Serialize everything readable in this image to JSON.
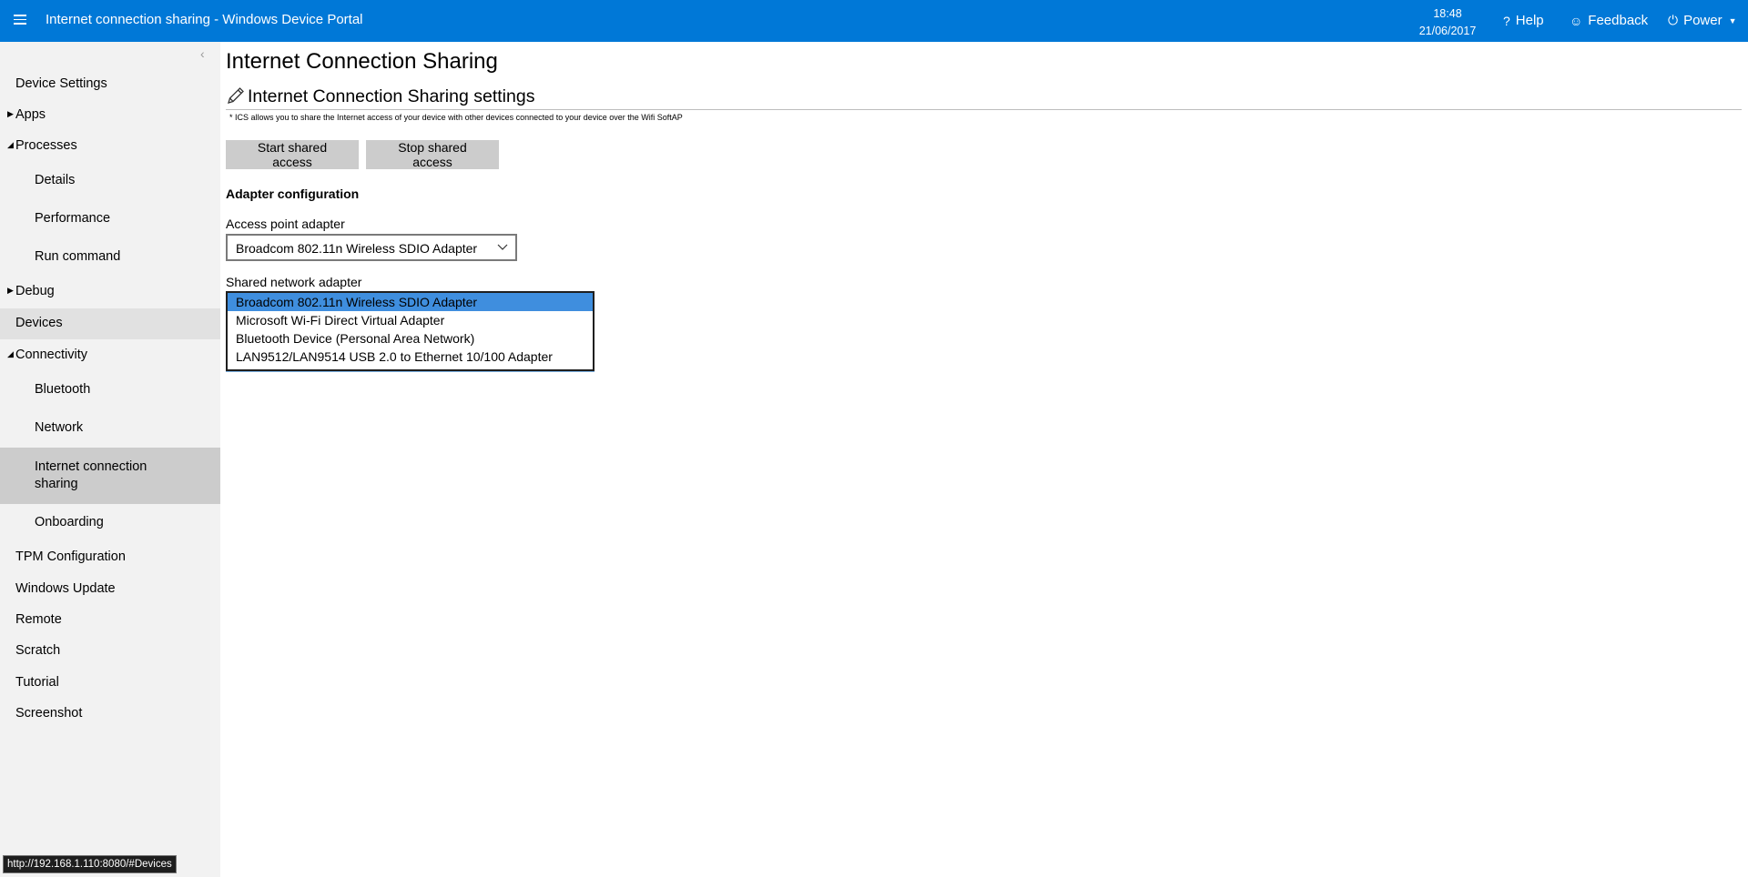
{
  "header": {
    "title": "Internet connection sharing - Windows Device Portal",
    "time": "18:48",
    "date": "21/06/2017",
    "help_label": "Help",
    "feedback_label": "Feedback",
    "power_label": "Power",
    "background_color": "#0078d7"
  },
  "sidebar": {
    "items": [
      {
        "label": "Device Settings"
      },
      {
        "label": "Apps"
      },
      {
        "label": "Processes"
      },
      {
        "label": "Details"
      },
      {
        "label": "Performance"
      },
      {
        "label": "Run command"
      },
      {
        "label": "Debug"
      },
      {
        "label": "Devices"
      },
      {
        "label": "Connectivity"
      },
      {
        "label": "Bluetooth"
      },
      {
        "label": "Network"
      },
      {
        "label": "Internet connection sharing"
      },
      {
        "label": "Onboarding"
      },
      {
        "label": "TPM Configuration"
      },
      {
        "label": "Windows Update"
      },
      {
        "label": "Remote"
      },
      {
        "label": "Scratch"
      },
      {
        "label": "Tutorial"
      },
      {
        "label": "Screenshot"
      }
    ]
  },
  "status_bar": {
    "url": "http://192.168.1.110:8080/#Devices"
  },
  "main": {
    "page_title": "Internet Connection Sharing",
    "settings_title": "Internet Connection Sharing settings",
    "note": "* ICS allows you to share the Internet access of your device with other devices connected to your device over the Wifi SoftAP",
    "start_button": "Start shared access",
    "stop_button": "Stop shared access",
    "adapter_heading": "Adapter configuration",
    "access_point_label": "Access point adapter",
    "access_point_value": "Broadcom 802.11n Wireless SDIO Adapter",
    "shared_label": "Shared network adapter",
    "shared_options": [
      "Broadcom 802.11n Wireless SDIO Adapter",
      "Microsoft Wi-Fi Direct Virtual Adapter",
      "Bluetooth Device (Personal Area Network)",
      "LAN9512/LAN9514 USB 2.0 to Ethernet 10/100 Adapter"
    ],
    "shared_selected": "Broadcom 802.11n Wireless SDIO Adapter"
  }
}
